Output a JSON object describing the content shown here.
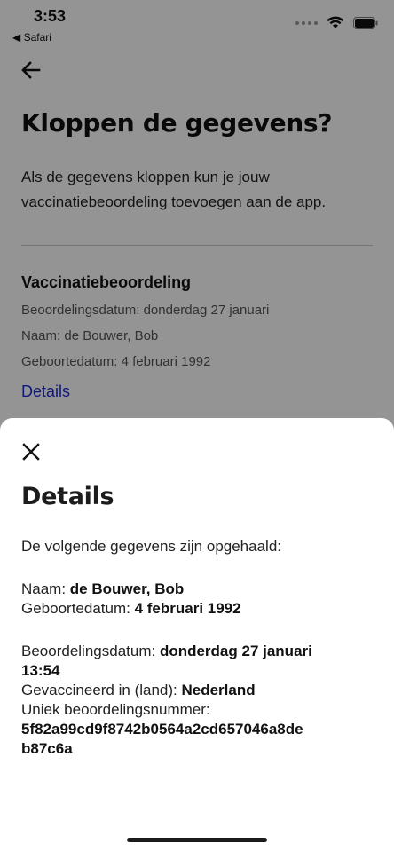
{
  "status": {
    "time": "3:53",
    "back_app": "◀ Safari"
  },
  "page": {
    "title": "Kloppen de gegevens?",
    "intro": "Als de gegevens kloppen kun je jouw vaccinatiebeoordeling toevoegen aan de app.",
    "section_title": "Vaccinatiebeoordeling",
    "meta": [
      "Beoordelingsdatum: donderdag 27 januari",
      "Naam: de Bouwer, Bob",
      "Geboortedatum: 4 februari 1992"
    ],
    "details_link": "Details"
  },
  "sheet": {
    "title": "Details",
    "intro": "De volgende gegevens zijn opgehaald:",
    "name_label": "Naam: ",
    "name_value": "de Bouwer, Bob",
    "birth_label": "Geboortedatum: ",
    "birth_value": "4 februari 1992",
    "date_label": "Beoordelingsdatum: ",
    "date_value_1": "donderdag 27 januari",
    "date_value_2": "13:54",
    "country_label": "Gevaccineerd in (land): ",
    "country_value": "Nederland",
    "id_label": "Uniek beoordelingsnummer:",
    "id_value_1": "5f82a99cd9f8742b0564a2cd657046a8de",
    "id_value_2": "b87c6a"
  },
  "colors": {
    "link": "#1e2ad8",
    "overlay": "rgba(0,0,0,0.42)"
  },
  "icons": {
    "back": "arrow-left-icon",
    "close": "close-icon"
  }
}
